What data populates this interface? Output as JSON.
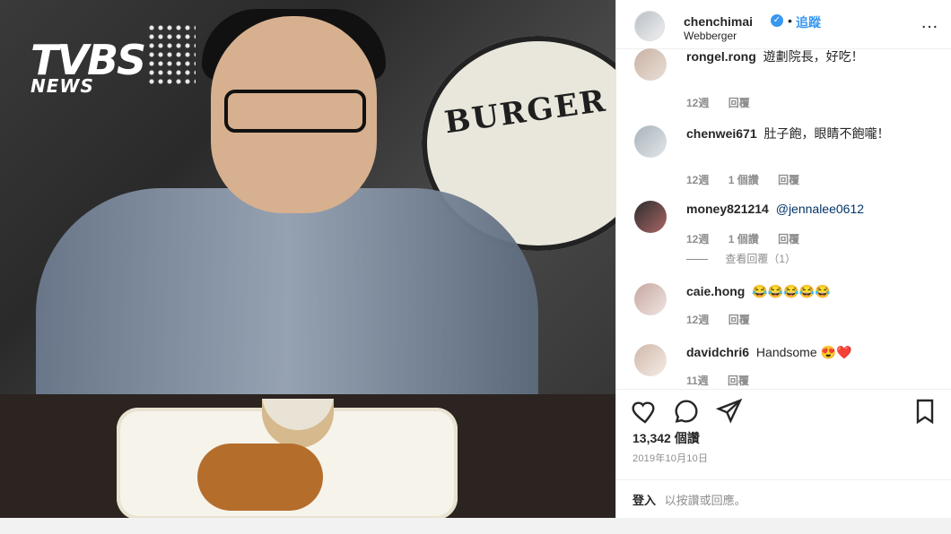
{
  "logo": {
    "primary": "TVBS",
    "secondary": "NEWS"
  },
  "post": {
    "username": "chenchimai",
    "dot": "•",
    "follow": "追蹤",
    "location": "Webberger",
    "likes": "13,342 個讚",
    "date": "2019年10月10日",
    "login_link": "登入",
    "login_hint": "以按讚或回應。"
  },
  "comments": [
    {
      "user": "rongel.rong",
      "text": "遊劃院長，好吃！",
      "time": "12週",
      "reply": "回覆",
      "likes": ""
    },
    {
      "user": "chenwei671",
      "text": "肚子飽，眼睛不飽嚨！",
      "time": "12週",
      "likes": "1 個讚",
      "reply": "回覆"
    },
    {
      "user": "money821214",
      "text": "@jennalee0612",
      "time": "12週",
      "likes": "1 個讚",
      "reply": "回覆",
      "view_replies": "查看回覆（1）"
    },
    {
      "user": "caie.hong",
      "text": "😂😂😂😂😂",
      "time": "12週",
      "reply": "回覆",
      "likes": ""
    },
    {
      "user": "davidchri6",
      "text": "Handsome 😍❤️",
      "time": "11週",
      "reply": "回覆",
      "likes": ""
    }
  ],
  "icons": {
    "heart": "heart-icon",
    "comment": "comment-icon",
    "share": "share-icon",
    "bookmark": "bookmark-icon",
    "verified": "verified-badge-icon"
  },
  "colors": {
    "accent": "#3897f0",
    "text": "#262626",
    "muted": "#8e8e8e"
  }
}
